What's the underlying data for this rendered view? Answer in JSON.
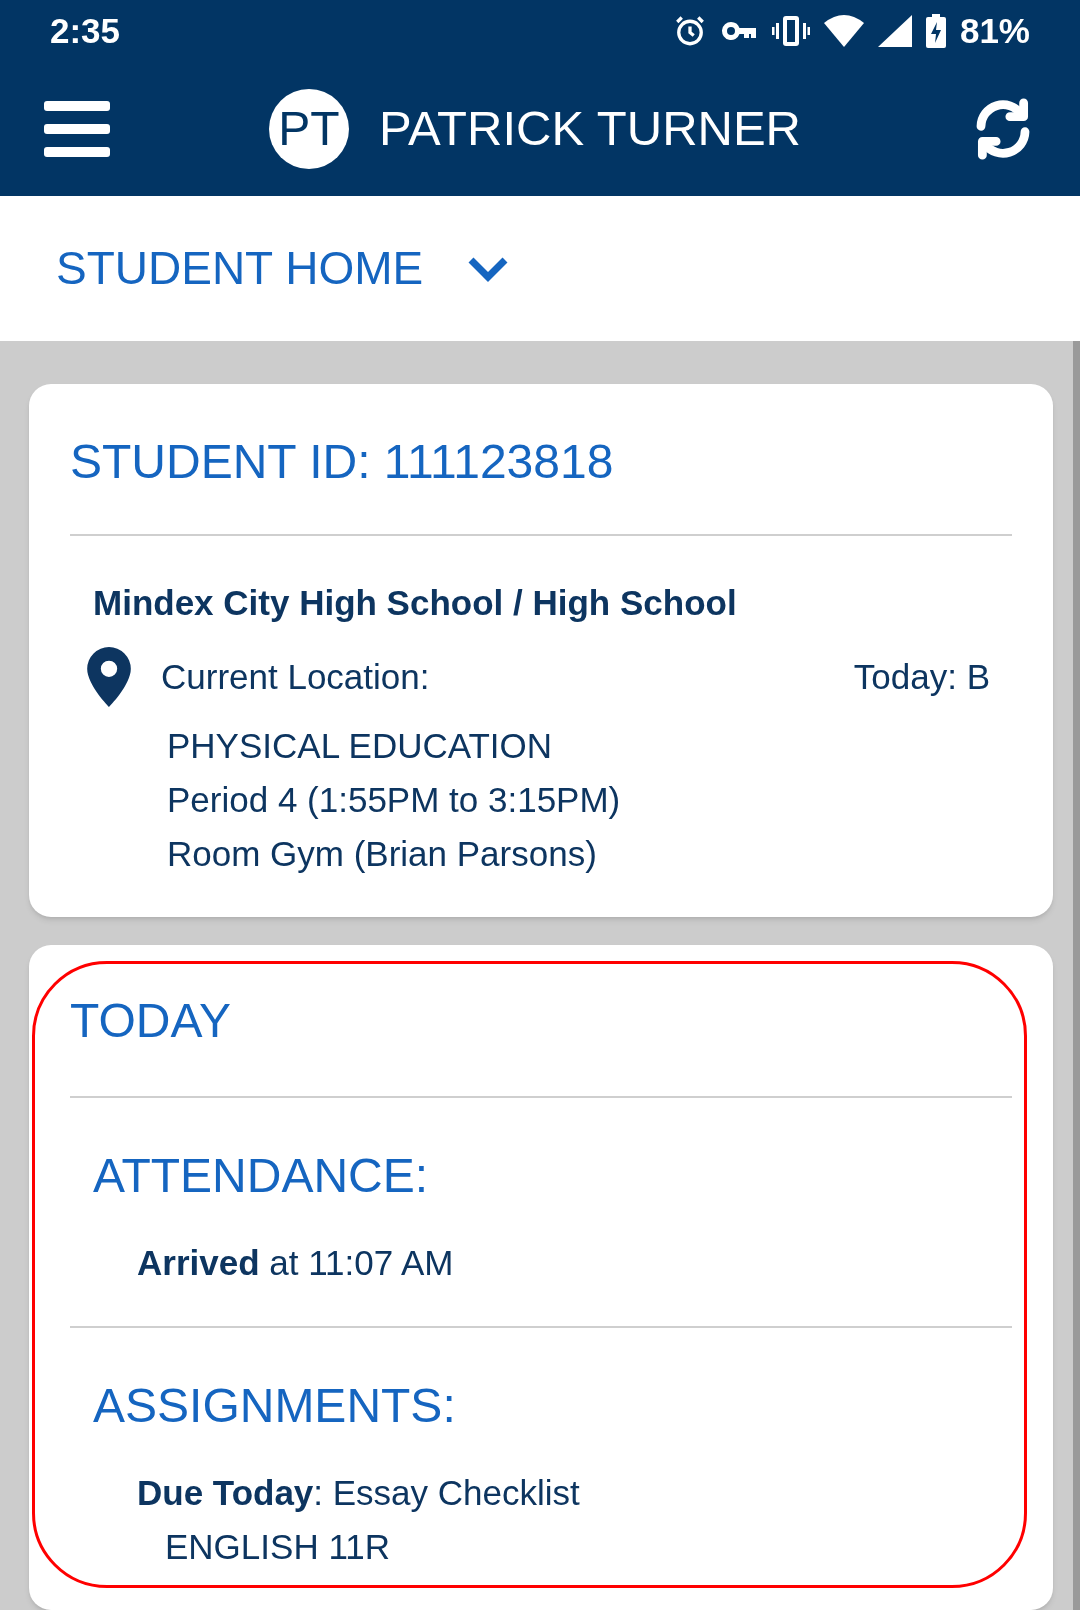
{
  "status_bar": {
    "time": "2:35",
    "battery": "81%"
  },
  "app_bar": {
    "avatar_initials": "PT",
    "title": "PATRICK TURNER"
  },
  "page_selector": {
    "label": "STUDENT HOME"
  },
  "student_card": {
    "title": "STUDENT ID: 111123818",
    "school": "Mindex City High School / High School",
    "location_label": "Current Location:",
    "day": "Today: B",
    "location_lines": [
      "PHYSICAL EDUCATION",
      "Period 4 (1:55PM to 3:15PM)",
      "Room Gym (Brian Parsons)"
    ]
  },
  "today_card": {
    "title": "TODAY",
    "highlighted": true,
    "sections": [
      {
        "heading": "ATTENDANCE:",
        "entries": [
          {
            "text": "**Arrived** at 11:07 AM"
          }
        ]
      },
      {
        "heading": "ASSIGNMENTS:",
        "entries": [
          {
            "text": "**Due Today**: Essay Checklist",
            "detail": "ENGLISH 11R"
          }
        ]
      }
    ]
  }
}
